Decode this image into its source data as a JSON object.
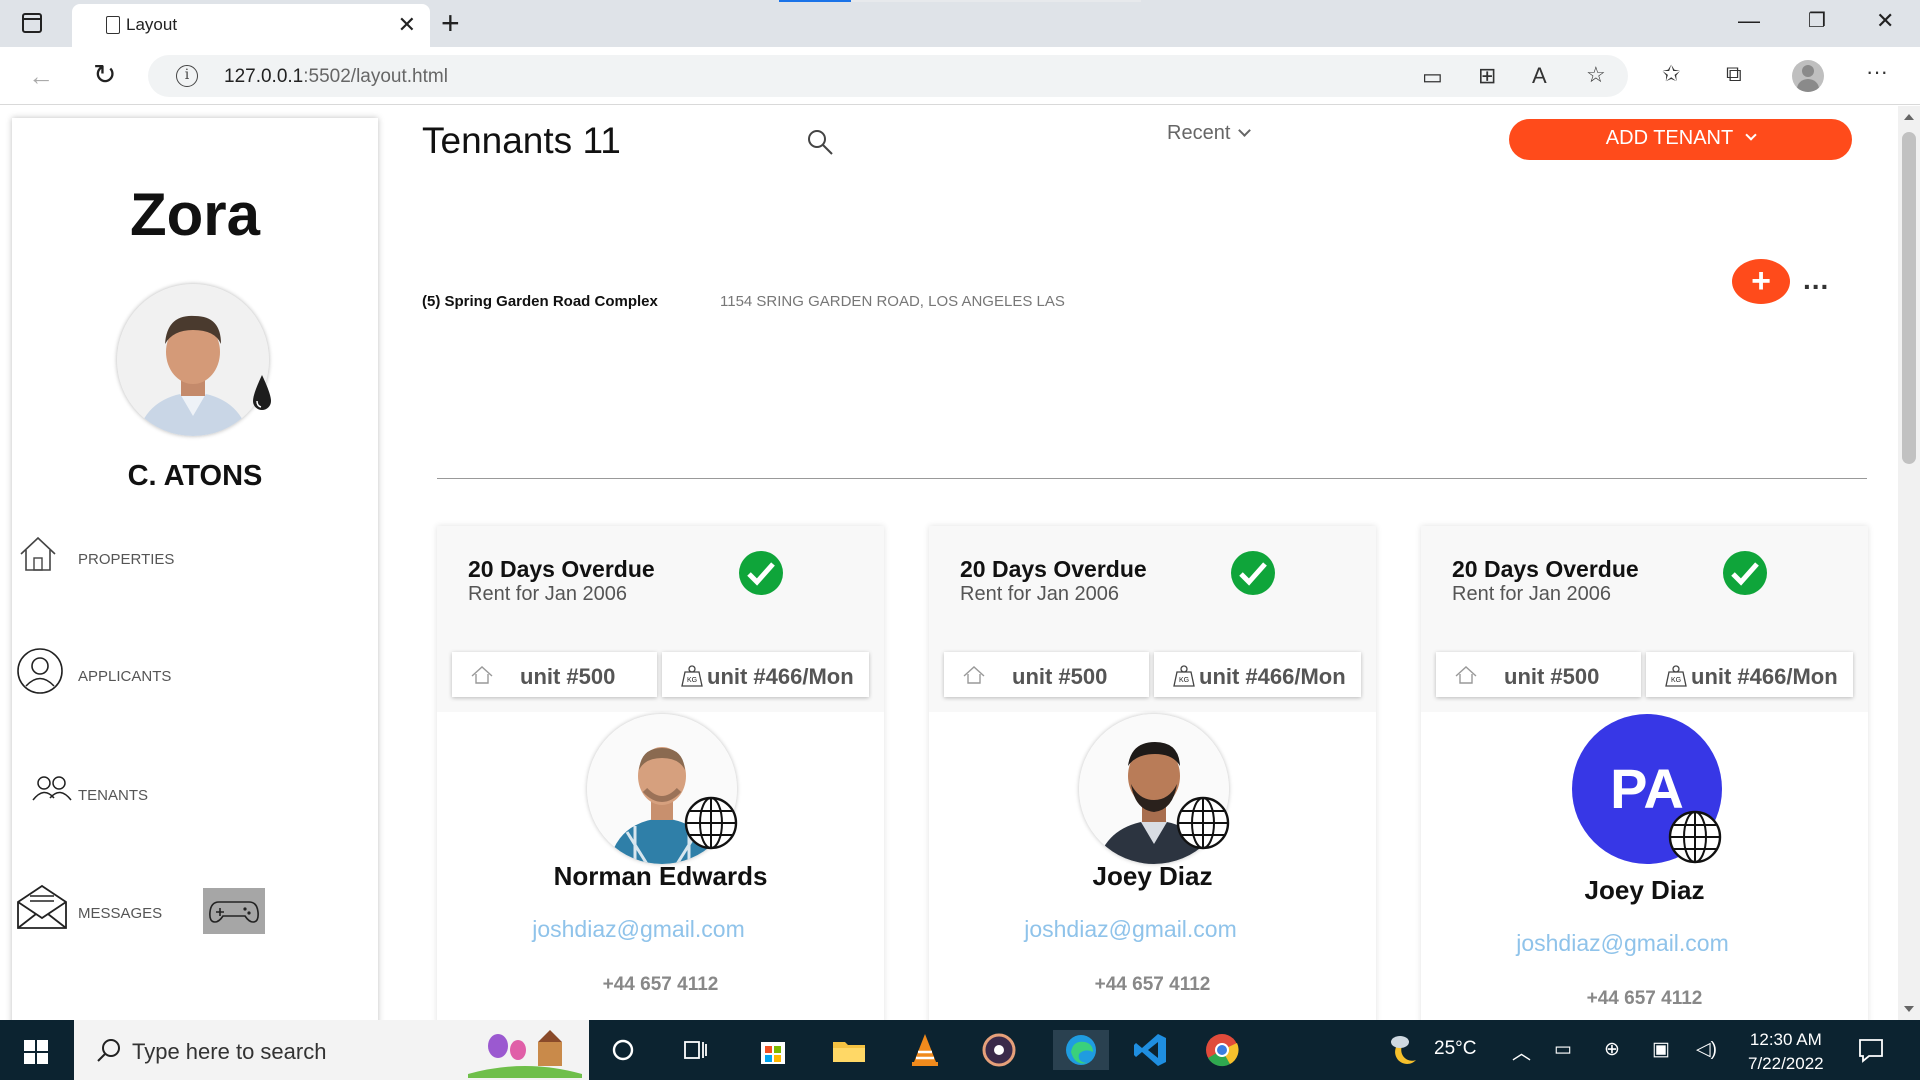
{
  "browser": {
    "tab_title": "Layout",
    "url_host": "127.0.0.1",
    "url_rest": ":5502/layout.html"
  },
  "sidebar": {
    "brand": "Zora",
    "user_name": "C. ATONS",
    "nav": [
      {
        "label": "PROPERTIES",
        "icon": "home-icon"
      },
      {
        "label": "APPLICANTS",
        "icon": "user-icon"
      },
      {
        "label": "TENANTS",
        "icon": "users-icon"
      },
      {
        "label": "MESSAGES",
        "icon": "envelope-icon"
      }
    ]
  },
  "header": {
    "title": "Tennants 11",
    "sort_value": "Recent",
    "add_tenant_label": "ADD TENANT"
  },
  "property": {
    "name": "(5) Spring Garden Road Complex",
    "address": "1154 SRING GARDEN ROAD, LOS ANGELES LAS",
    "more_label": "..."
  },
  "cards": [
    {
      "overdue": "20 Days Overdue",
      "rent_for": "Rent for Jan 2006",
      "unit": "unit #500",
      "rent_unit": "unit #466/Mon",
      "name": "Norman Edwards",
      "email": "joshdiaz@gmail.com",
      "phone": "+44 657 4112",
      "avatar": "photo"
    },
    {
      "overdue": "20 Days Overdue",
      "rent_for": "Rent for Jan 2006",
      "unit": "unit #500",
      "rent_unit": "unit #466/Mon",
      "name": "Joey Diaz",
      "email": "joshdiaz@gmail.com",
      "phone": "+44 657 4112",
      "avatar": "photo"
    },
    {
      "overdue": "20 Days Overdue",
      "rent_for": "Rent for Jan 2006",
      "unit": "unit #500",
      "rent_unit": "unit #466/Mon",
      "name": "Joey Diaz",
      "email": "joshdiaz@gmail.com",
      "phone": "+44 657 4112",
      "avatar": "initials",
      "initials": "PA"
    }
  ],
  "taskbar": {
    "search_placeholder": "Type here to search",
    "temperature": "25°C",
    "time": "12:30 AM",
    "date": "7/22/2022"
  },
  "colors": {
    "accent": "#ff4b1b",
    "check": "#0fa53a",
    "email": "#8fc3ea",
    "initials_avatar": "#3737e6"
  }
}
